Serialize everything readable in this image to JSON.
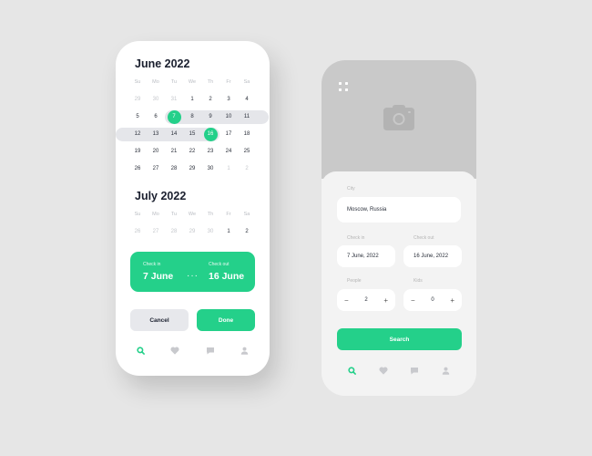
{
  "calendar": {
    "weekdays": [
      "Su",
      "Mo",
      "Tu",
      "We",
      "Th",
      "Fr",
      "Sa"
    ],
    "june": {
      "title": "June 2022",
      "rows": [
        [
          {
            "d": "29",
            "m": true
          },
          {
            "d": "30",
            "m": true
          },
          {
            "d": "31",
            "m": true
          },
          {
            "d": "1"
          },
          {
            "d": "2"
          },
          {
            "d": "3"
          },
          {
            "d": "4"
          }
        ],
        [
          {
            "d": "5"
          },
          {
            "d": "6"
          },
          {
            "d": "7",
            "s": true
          },
          {
            "d": "8"
          },
          {
            "d": "9"
          },
          {
            "d": "10"
          },
          {
            "d": "11"
          }
        ],
        [
          {
            "d": "12"
          },
          {
            "d": "13"
          },
          {
            "d": "14"
          },
          {
            "d": "15"
          },
          {
            "d": "16",
            "s": true
          },
          {
            "d": "17"
          },
          {
            "d": "18"
          }
        ],
        [
          {
            "d": "19"
          },
          {
            "d": "20"
          },
          {
            "d": "21"
          },
          {
            "d": "22"
          },
          {
            "d": "23"
          },
          {
            "d": "24"
          },
          {
            "d": "25"
          }
        ],
        [
          {
            "d": "26"
          },
          {
            "d": "27"
          },
          {
            "d": "28"
          },
          {
            "d": "29"
          },
          {
            "d": "30"
          },
          {
            "d": "1",
            "m": true
          },
          {
            "d": "2",
            "m": true
          }
        ]
      ]
    },
    "july": {
      "title": "July 2022",
      "rows": [
        [
          {
            "d": "26",
            "m": true
          },
          {
            "d": "27",
            "m": true
          },
          {
            "d": "28",
            "m": true
          },
          {
            "d": "29",
            "m": true
          },
          {
            "d": "30",
            "m": true
          },
          {
            "d": "1"
          },
          {
            "d": "2"
          }
        ]
      ]
    },
    "summary": {
      "checkin_label": "Check in",
      "checkin_value": "7 June",
      "dots": "···",
      "checkout_label": "Check out",
      "checkout_value": "16 June"
    },
    "cancel_label": "Cancel",
    "done_label": "Done"
  },
  "search_form": {
    "city_label": "City",
    "city_value": "Moscow, Russia",
    "checkin_label": "Check in",
    "checkin_value": "7 June, 2022",
    "checkout_label": "Check out",
    "checkout_value": "16 June, 2022",
    "people_label": "People",
    "people_value": "2",
    "kids_label": "Kids",
    "kids_value": "0",
    "minus": "−",
    "plus": "+",
    "search_label": "Search"
  },
  "nav": [
    "search",
    "favorites",
    "messages",
    "profile"
  ],
  "colors": {
    "accent": "#24d08a",
    "range": "#e5e6ea",
    "hero": "#c9c9c9"
  }
}
